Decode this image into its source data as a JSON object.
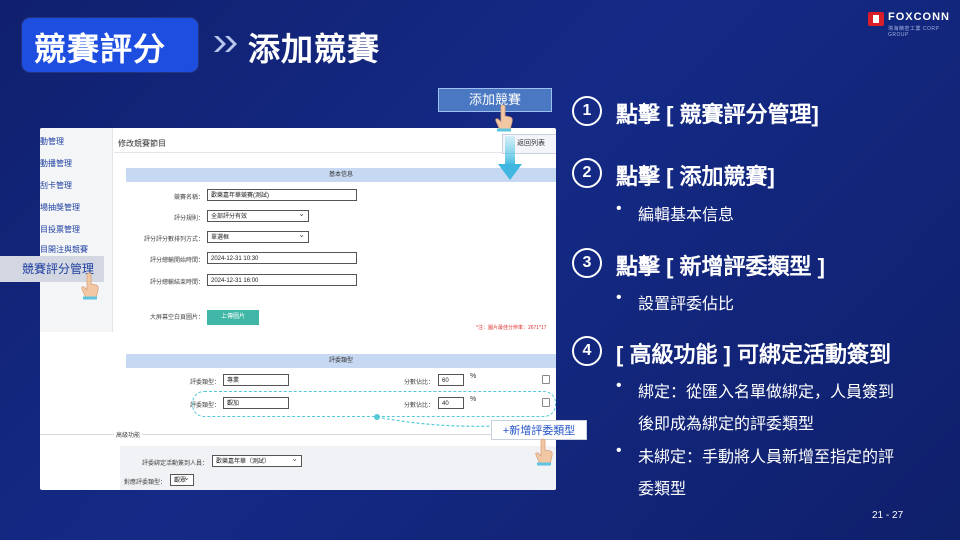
{
  "header": {
    "section": "競賽評分",
    "title": "添加競賽",
    "logo_text": "FOXCONN",
    "logo_sub": "鴻海精密工業 CORP GROUP"
  },
  "screenshot": {
    "sidebar": [
      "動管理",
      "動播管理",
      "刮卡管理",
      "場抽獎管理",
      "目投票管理",
      "目開注與競賽"
    ],
    "page_title": "修改競賽節目",
    "back_button": "返回列表",
    "basic_section": "基本信息",
    "fields": [
      {
        "label": "競賽名稱：",
        "value": "歡樂嘉年華競賽(測試)"
      },
      {
        "label": "評分規則：",
        "value": "全部評分有效"
      },
      {
        "label": "評分評分數排列方式：",
        "value": "單選框"
      },
      {
        "label": "評分總輸開始時間：",
        "value": "2024-12-31 10:30"
      },
      {
        "label": "評分總輸結束時間：",
        "value": "2024-12-31 16:00"
      }
    ],
    "bg_label": "大屏幕空白頁圖片：",
    "upload_button": "上傳圖片",
    "note": "*注：圖片最佳分辨率：2671*17",
    "judge_section": "評委類型",
    "judge_rows": [
      {
        "type_label": "評委類型：",
        "type_value": "專業",
        "score_label": "分數佔比：",
        "score": "60",
        "unit": "%"
      },
      {
        "type_label": "評委類型：",
        "type_value": "觀加",
        "score_label": "分數佔比：",
        "score": "40",
        "unit": "%"
      }
    ],
    "advanced_label": "高級功能",
    "bind_label": "評委綁定活動簽到人員：",
    "bind_value": "歡樂嘉年華（測試）",
    "bind_type_label": "對應評委類型：",
    "bind_type_value": "觀眾"
  },
  "callouts": {
    "add_button": "添加競賽",
    "menu_item": "競賽評分管理",
    "new_type": "+新增評委類型"
  },
  "steps": [
    {
      "num": "1",
      "text": "點擊 [ 競賽評分管理]"
    },
    {
      "num": "2",
      "text": "點擊 [ 添加競賽]"
    },
    {
      "num": "3",
      "text": "點擊 [ 新增評委類型 ]"
    },
    {
      "num": "4",
      "text": "[ 高級功能 ] 可綁定活動簽到"
    }
  ],
  "bullets": {
    "step2": "編輯基本信息",
    "step3": "設置評委佔比",
    "step4a_line1": "綁定：從匯入名單做綁定，人員簽到",
    "step4a_line2": "後即成為綁定的評委類型",
    "step4b_line1": "未綁定：手動將人員新增至指定的評",
    "step4b_line2": "委類型"
  },
  "page_number": "21 - 27",
  "colors": {
    "background": "#142a86",
    "accent": "#1d4ee0",
    "highlight": "#55c9d8"
  }
}
